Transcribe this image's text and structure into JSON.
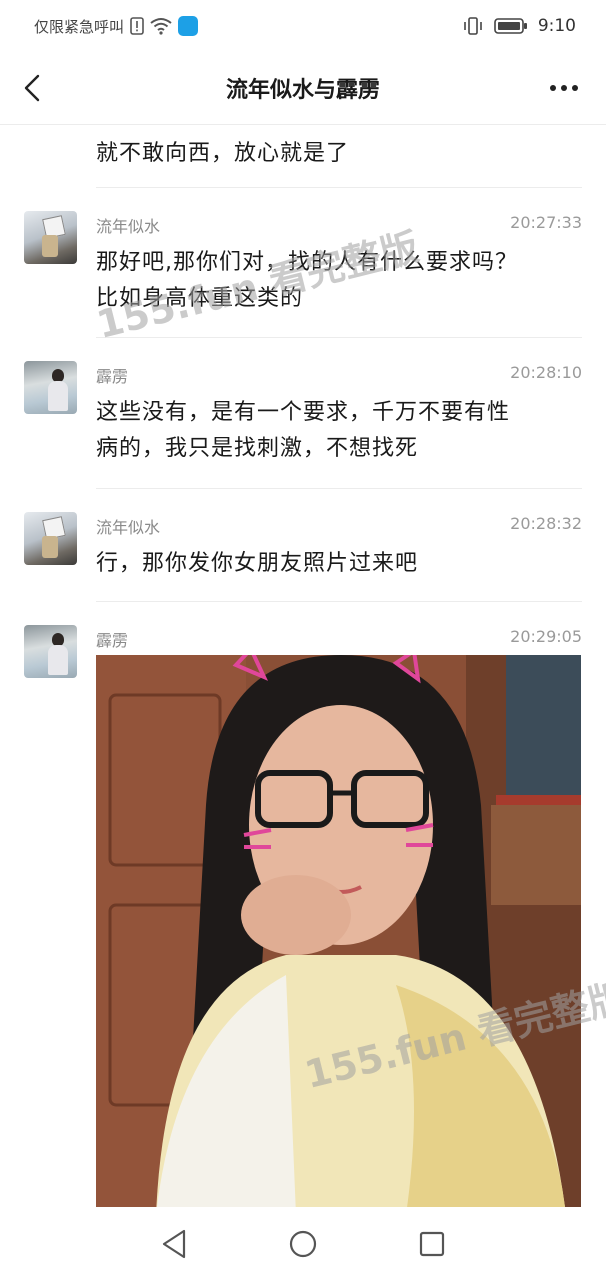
{
  "status_bar": {
    "carrier_text": "仅限紧急呼叫",
    "time": "9:10"
  },
  "header": {
    "title": "流年似水与霹雳"
  },
  "watermark": "155.fun 看完整版",
  "chat": {
    "partial_text": "就不敢向西，放心就是了",
    "messages": [
      {
        "sender": "流年似水",
        "time": "20:27:33",
        "lines": [
          "那好吧,那你们对，找的人有什么要求吗？",
          "比如身高体重这类的"
        ]
      },
      {
        "sender": "霹雳",
        "time": "20:28:10",
        "lines": [
          "这些没有，是有一个要求，千万不要有性",
          "病的，我只是找刺激，不想找死"
        ]
      },
      {
        "sender": "流年似水",
        "time": "20:28:32",
        "lines": [
          "行，那你发你女朋友照片过来吧"
        ]
      },
      {
        "sender": "霹雳",
        "time": "20:29:05",
        "image": true
      }
    ]
  },
  "icons": {
    "back": "back-arrow-icon",
    "more": "more-dots-icon",
    "nav": [
      "nav-back-icon",
      "nav-home-icon",
      "nav-recents-icon"
    ]
  }
}
